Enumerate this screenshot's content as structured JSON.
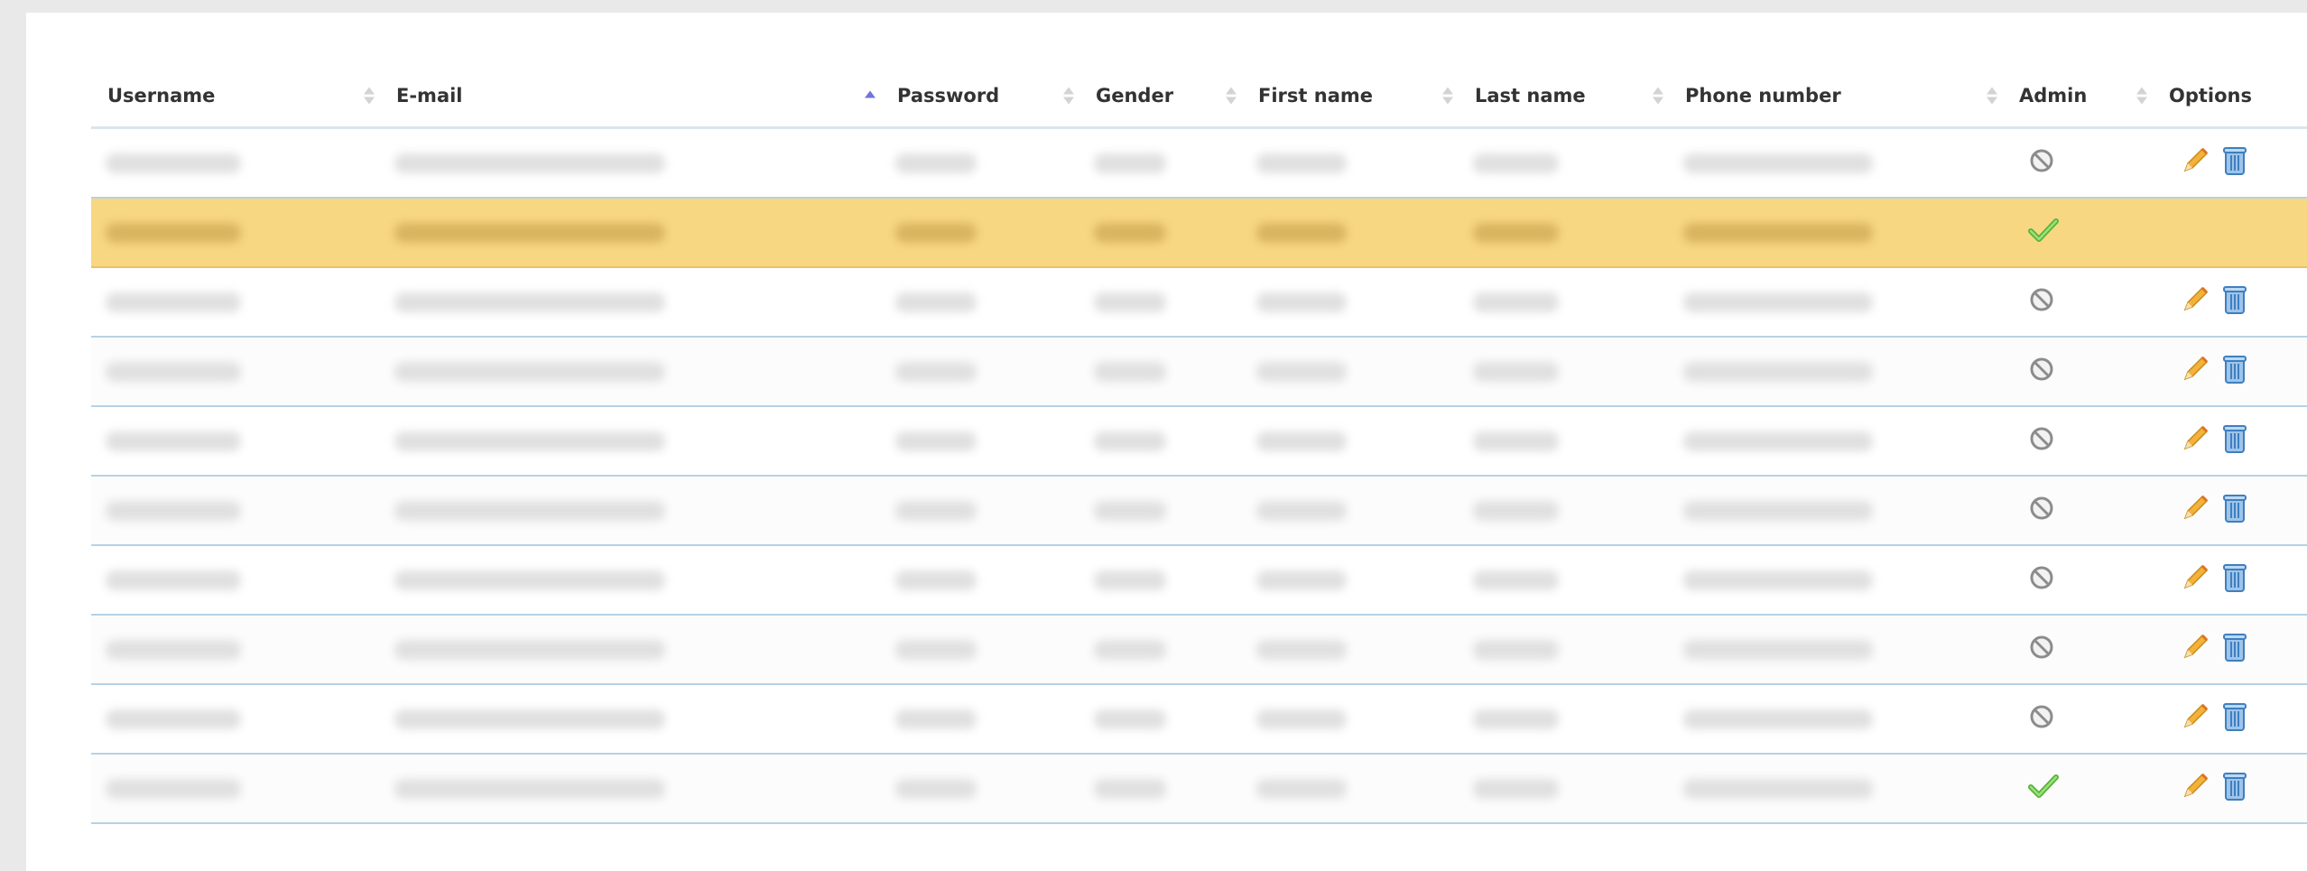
{
  "table": {
    "columns": [
      {
        "key": "username",
        "label": "Username",
        "sort": "none"
      },
      {
        "key": "email",
        "label": "E-mail",
        "sort": "asc"
      },
      {
        "key": "password",
        "label": "Password",
        "sort": "none"
      },
      {
        "key": "gender",
        "label": "Gender",
        "sort": "none"
      },
      {
        "key": "first_name",
        "label": "First name",
        "sort": "none"
      },
      {
        "key": "last_name",
        "label": "Last name",
        "sort": "none"
      },
      {
        "key": "phone",
        "label": "Phone number",
        "sort": "none"
      },
      {
        "key": "admin",
        "label": "Admin",
        "sort": "none"
      },
      {
        "key": "options",
        "label": "Options",
        "sort": "none"
      }
    ],
    "rows": [
      {
        "admin": false,
        "highlighted": false,
        "has_options": true
      },
      {
        "admin": true,
        "highlighted": true,
        "has_options": false
      },
      {
        "admin": false,
        "highlighted": false,
        "has_options": true
      },
      {
        "admin": false,
        "highlighted": false,
        "has_options": true
      },
      {
        "admin": false,
        "highlighted": false,
        "has_options": true
      },
      {
        "admin": false,
        "highlighted": false,
        "has_options": true
      },
      {
        "admin": false,
        "highlighted": false,
        "has_options": true
      },
      {
        "admin": false,
        "highlighted": false,
        "has_options": true
      },
      {
        "admin": false,
        "highlighted": false,
        "has_options": true
      },
      {
        "admin": true,
        "highlighted": false,
        "has_options": true
      }
    ],
    "icons": {
      "admin_true": "checkmark-icon",
      "admin_false": "no-entry-icon",
      "edit": "pencil-icon",
      "delete": "trash-icon"
    },
    "colors": {
      "highlight_row": "#f8d783",
      "sort_active": "#6f74e0",
      "row_border": "#b7d2e3"
    }
  }
}
